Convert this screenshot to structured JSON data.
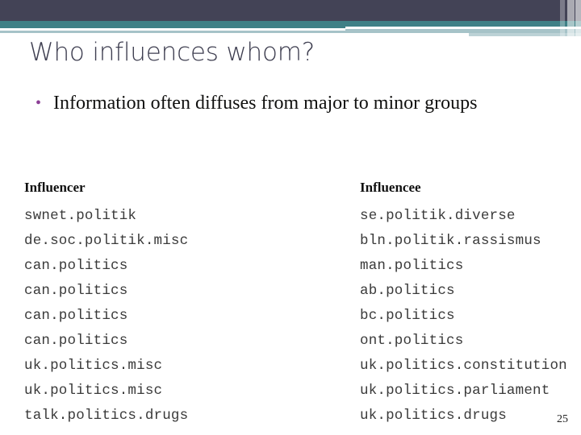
{
  "slide": {
    "title": "Who influences whom?",
    "page_number": "25",
    "bullets": [
      {
        "marker": "•",
        "text": "Information often diffuses from major to minor groups"
      }
    ],
    "theme": {
      "band_dark": "#434356",
      "band_teal": "#3f8086",
      "band_pale": "#a6c3c8",
      "band_pale_light": "#bcd2d6",
      "title_color": "#3e3e50",
      "bullet_marker_color": "#8c3f96",
      "body_text_color": "#10100f",
      "mono_text_color": "#3a3a3a",
      "background": "#ffffff"
    }
  },
  "table": {
    "columns": [
      {
        "header": "Influencer",
        "cells": [
          "swnet.politik",
          "de.soc.politik.misc",
          "can.politics",
          "can.politics",
          "can.politics",
          "can.politics",
          "uk.politics.misc",
          "uk.politics.misc",
          "talk.politics.drugs"
        ]
      },
      {
        "header": "Influencee",
        "cells": [
          "se.politik.diverse",
          "bln.politik.rassismus",
          "man.politics",
          "ab.politics",
          "bc.politics",
          "ont.politics",
          "uk.politics.constitution",
          "uk.politics.parliament",
          "uk.politics.drugs"
        ]
      }
    ]
  }
}
